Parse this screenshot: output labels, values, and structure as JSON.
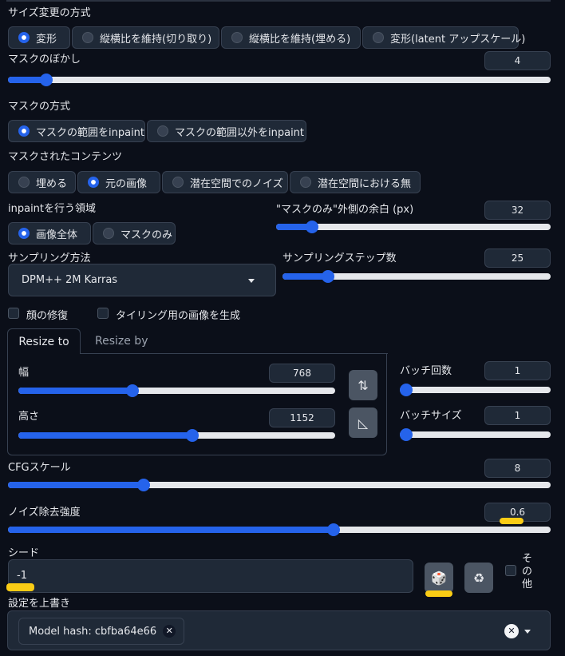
{
  "resize_mode": {
    "label": "サイズ変更の方式",
    "options": [
      "変形",
      "縦横比を維持(切り取り)",
      "縦横比を維持(埋める)",
      "変形(latent アップスケール)"
    ],
    "selected": "変形"
  },
  "mask_blur": {
    "label": "マスクのぼかし",
    "value": "4",
    "fraction": 0.07
  },
  "mask_mode": {
    "label": "マスクの方式",
    "options": [
      "マスクの範囲をinpaint",
      "マスクの範囲以外をinpaint"
    ],
    "selected": "マスクの範囲をinpaint"
  },
  "masked_content": {
    "label": "マスクされたコンテンツ",
    "options": [
      "埋める",
      "元の画像",
      "潜在空間でのノイズ",
      "潜在空間における無"
    ],
    "selected": "元の画像"
  },
  "inpaint_area": {
    "label": "inpaintを行う領域",
    "options": [
      "画像全体",
      "マスクのみ"
    ],
    "selected": "画像全体"
  },
  "only_masked_padding": {
    "label": "\"マスクのみ\"外側の余白 (px)",
    "value": "32",
    "fraction": 0.13
  },
  "sampling_method": {
    "label": "サンプリング方法",
    "value": "DPM++ 2M Karras"
  },
  "sampling_steps": {
    "label": "サンプリングステップ数",
    "value": "25",
    "fraction": 0.17
  },
  "checkboxes": {
    "restore_faces": "顔の修復",
    "tiling": "タイリング用の画像を生成"
  },
  "resize_tabs": [
    "Resize to",
    "Resize by"
  ],
  "width": {
    "label": "幅",
    "value": "768",
    "fraction": 0.36
  },
  "height": {
    "label": "高さ",
    "value": "1152",
    "fraction": 0.55
  },
  "batch_count": {
    "label": "バッチ回数",
    "value": "1",
    "fraction": 0.0
  },
  "batch_size": {
    "label": "バッチサイズ",
    "value": "1",
    "fraction": 0.0
  },
  "cfg_scale": {
    "label": "CFGスケール",
    "value": "8",
    "fraction": 0.25
  },
  "denoising": {
    "label": "ノイズ除去強度",
    "value": "0.6",
    "fraction": 0.6
  },
  "seed": {
    "label": "シード",
    "value": "-1"
  },
  "extra": {
    "label": "その他"
  },
  "override": {
    "label": "設定を上書き",
    "chip": "Model hash: cbfba64e66"
  },
  "icons": {
    "swap": "swap-icon",
    "ratio": "ratio-icon",
    "dice": "dice-icon",
    "recycle": "recycle-icon"
  },
  "colors": {
    "accent": "#2563eb",
    "highlight": "#facc15",
    "bg": "#0b0f19",
    "panel": "#1f2937"
  }
}
